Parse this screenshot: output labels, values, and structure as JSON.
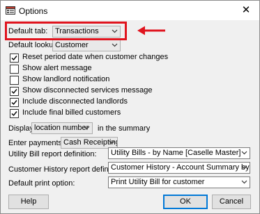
{
  "window": {
    "title": "Options",
    "close_glyph": "✕"
  },
  "fields": {
    "default_tab": {
      "label": "Default tab:",
      "value": "Transactions"
    },
    "default_lookup": {
      "label": "Default lookup:",
      "value": "Customer"
    }
  },
  "checkboxes": [
    {
      "label": "Reset period date when customer changes",
      "checked": true
    },
    {
      "label": "Show alert message",
      "checked": false
    },
    {
      "label": "Show landlord notification",
      "checked": false
    },
    {
      "label": "Show disconnected services message",
      "checked": true
    },
    {
      "label": "Include disconnected landlords",
      "checked": true
    },
    {
      "label": "Include final billed customers",
      "checked": true
    }
  ],
  "display": {
    "prefix": "Display",
    "value": "location number",
    "suffix": "in the summary"
  },
  "payments": {
    "label": "Enter payments in",
    "value": "Cash Receipting"
  },
  "utility_bill": {
    "label": "Utility Bill report definition:",
    "value": "Utility Bills - by Name [Caselle Master]"
  },
  "customer_history": {
    "label": "Customer History report definition:",
    "value": "Customer History - Account Summary by Name [Caselle"
  },
  "default_print": {
    "label": "Default print option:",
    "value": "Print Utility Bill for customer"
  },
  "buttons": {
    "help": "Help",
    "ok": "OK",
    "cancel": "Cancel"
  },
  "annotation_color": "#e0141e",
  "icons": {
    "app": "options-app-icon",
    "dropdown": "chevron-down-icon",
    "check": "check-icon"
  }
}
